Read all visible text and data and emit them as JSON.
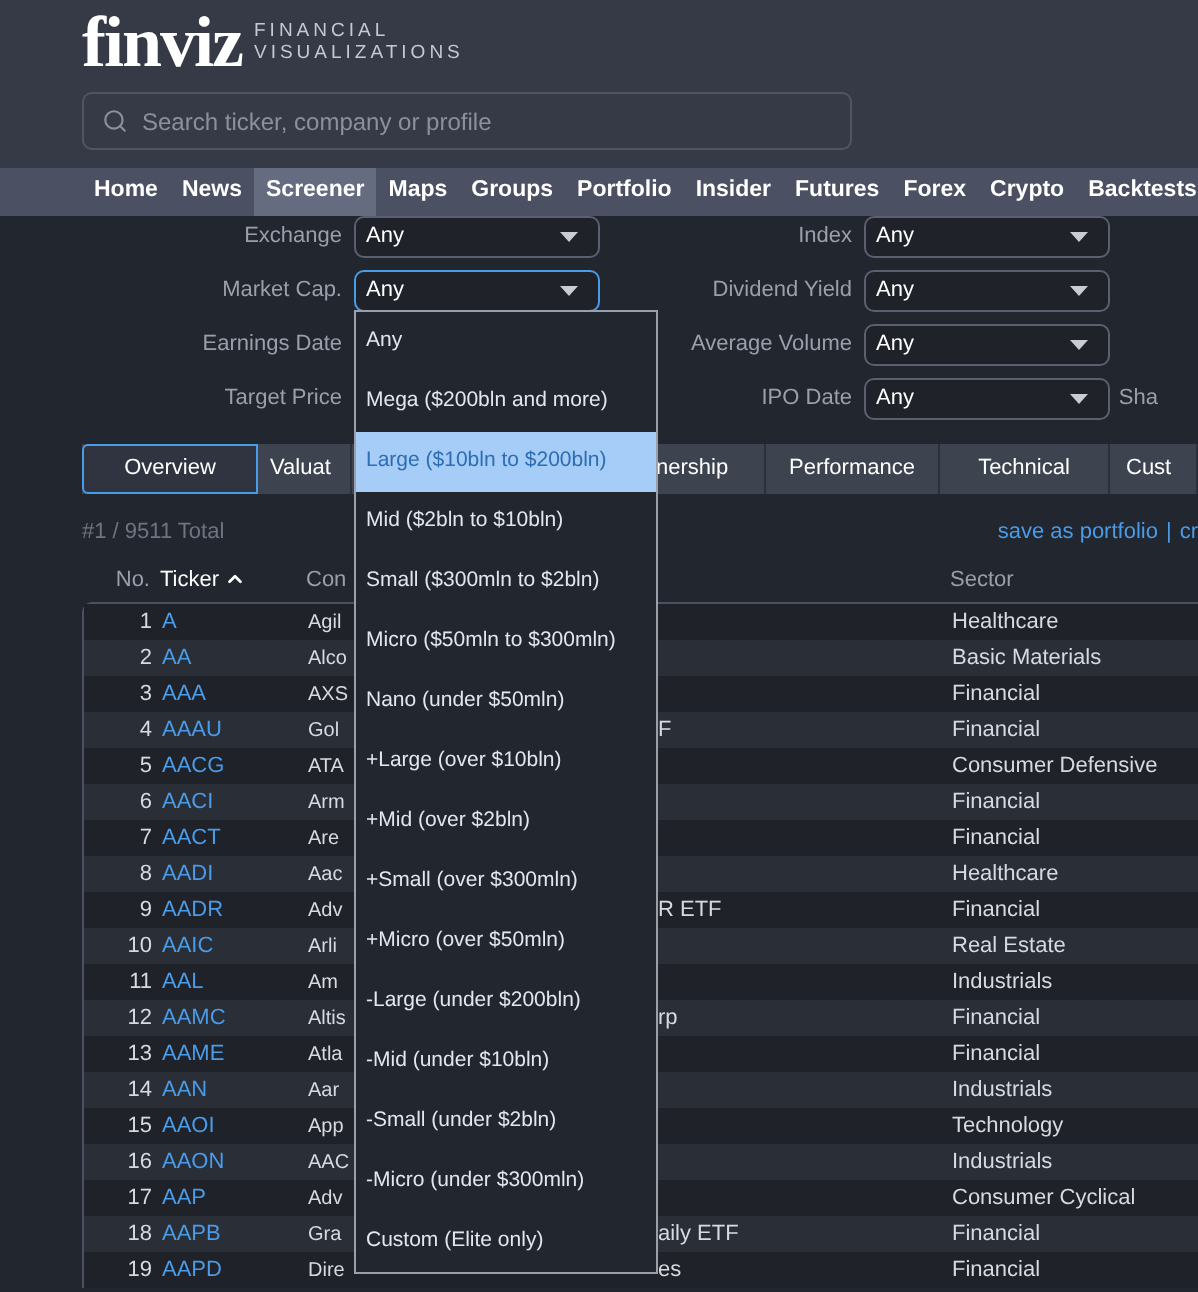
{
  "header": {
    "logo": "finviz",
    "tagline": [
      "FINANCIAL",
      "VISUALIZATIONS"
    ],
    "search": {
      "placeholder": "Search ticker, company or profile"
    }
  },
  "nav": [
    {
      "label": "Home",
      "selected": false
    },
    {
      "label": "News",
      "selected": false
    },
    {
      "label": "Screener",
      "selected": true
    },
    {
      "label": "Maps",
      "selected": false
    },
    {
      "label": "Groups",
      "selected": false
    },
    {
      "label": "Portfolio",
      "selected": false
    },
    {
      "label": "Insider",
      "selected": false
    },
    {
      "label": "Futures",
      "selected": false
    },
    {
      "label": "Forex",
      "selected": false
    },
    {
      "label": "Crypto",
      "selected": false
    },
    {
      "label": "Backtests",
      "selected": false
    }
  ],
  "filters": [
    [
      {
        "label": "Exchange",
        "value": "Any",
        "focused": false
      },
      {
        "label": "Index",
        "value": "Any",
        "focused": false
      }
    ],
    [
      {
        "label": "Market Cap.",
        "value": "Any",
        "focused": true
      },
      {
        "label": "Dividend Yield",
        "value": "Any",
        "focused": false
      }
    ],
    [
      {
        "label": "Earnings Date"
      },
      {
        "label": "Average Volume",
        "value": "Any",
        "focused": false
      }
    ],
    [
      {
        "label": "Target Price"
      },
      {
        "label": "IPO Date",
        "value": "Any",
        "focused": false
      },
      {
        "label": "Sha"
      }
    ]
  ],
  "view_tabs": [
    {
      "label": "Overview",
      "selected": true
    },
    {
      "label": "Valuat",
      "selected": false
    },
    {
      "label": "nership",
      "selected": false
    },
    {
      "label": "Performance",
      "selected": false
    },
    {
      "label": "Technical",
      "selected": false
    },
    {
      "label": "Cust",
      "selected": false
    }
  ],
  "summary": {
    "total": "#1 / 9511 Total",
    "links": [
      "save as portfolio",
      "|",
      "cr"
    ]
  },
  "table": {
    "columns": [
      {
        "label": "No.",
        "sorted": false
      },
      {
        "label": "Ticker",
        "sorted": true
      },
      {
        "label": "Con",
        "sorted": false
      },
      {
        "label": "Sector",
        "sorted": false
      }
    ],
    "rows": [
      {
        "no": "1",
        "ticker": "A",
        "company": "Agil",
        "sector": "Healthcare"
      },
      {
        "no": "2",
        "ticker": "AA",
        "company": "Alco",
        "sector": "Basic Materials"
      },
      {
        "no": "3",
        "ticker": "AAA",
        "company": "AXS",
        "sector": "Financial"
      },
      {
        "no": "4",
        "ticker": "AAAU",
        "company": "Gol",
        "company_tail": "F",
        "sector": "Financial"
      },
      {
        "no": "5",
        "ticker": "AACG",
        "company": "ATA",
        "sector": "Consumer Defensive"
      },
      {
        "no": "6",
        "ticker": "AACI",
        "company": "Arm",
        "sector": "Financial"
      },
      {
        "no": "7",
        "ticker": "AACT",
        "company": "Are",
        "sector": "Financial"
      },
      {
        "no": "8",
        "ticker": "AADI",
        "company": "Aac",
        "sector": "Healthcare"
      },
      {
        "no": "9",
        "ticker": "AADR",
        "company": "Adv",
        "company_tail": "R ETF",
        "sector": "Financial"
      },
      {
        "no": "10",
        "ticker": "AAIC",
        "company": "Arli",
        "sector": "Real Estate"
      },
      {
        "no": "11",
        "ticker": "AAL",
        "company": "Am",
        "sector": "Industrials"
      },
      {
        "no": "12",
        "ticker": "AAMC",
        "company": "Altis",
        "company_tail": "rp",
        "sector": "Financial"
      },
      {
        "no": "13",
        "ticker": "AAME",
        "company": "Atla",
        "sector": "Financial"
      },
      {
        "no": "14",
        "ticker": "AAN",
        "company": "Aar",
        "sector": "Industrials"
      },
      {
        "no": "15",
        "ticker": "AAOI",
        "company": "App",
        "sector": "Technology"
      },
      {
        "no": "16",
        "ticker": "AAON",
        "company": "AAC",
        "sector": "Industrials"
      },
      {
        "no": "17",
        "ticker": "AAP",
        "company": "Adv",
        "sector": "Consumer Cyclical"
      },
      {
        "no": "18",
        "ticker": "AAPB",
        "company": "Gra",
        "company_tail": "aily ETF",
        "sector": "Financial"
      },
      {
        "no": "19",
        "ticker": "AAPD",
        "company": "Dire",
        "company_tail": "es",
        "sector": "Financial"
      }
    ]
  },
  "dropdown": [
    {
      "label": "Any",
      "selected": false
    },
    {
      "label": "Mega ($200bln and more)",
      "selected": false
    },
    {
      "label": "Large ($10bln to $200bln)",
      "selected": true
    },
    {
      "label": "Mid ($2bln to $10bln)",
      "selected": false
    },
    {
      "label": "Small ($300mln to $2bln)",
      "selected": false
    },
    {
      "label": "Micro ($50mln to $300mln)",
      "selected": false
    },
    {
      "label": "Nano (under $50mln)",
      "selected": false
    },
    {
      "label": "+Large (over $10bln)",
      "selected": false
    },
    {
      "label": "+Mid (over $2bln)",
      "selected": false
    },
    {
      "label": "+Small (over $300mln)",
      "selected": false
    },
    {
      "label": "+Micro (over $50mln)",
      "selected": false
    },
    {
      "label": "-Large (under $200bln)",
      "selected": false
    },
    {
      "label": "-Mid (under $10bln)",
      "selected": false
    },
    {
      "label": "-Small (under $2bln)",
      "selected": false
    },
    {
      "label": "-Micro (under $300mln)",
      "selected": false
    },
    {
      "label": "Custom (Elite only)",
      "selected": false
    }
  ]
}
